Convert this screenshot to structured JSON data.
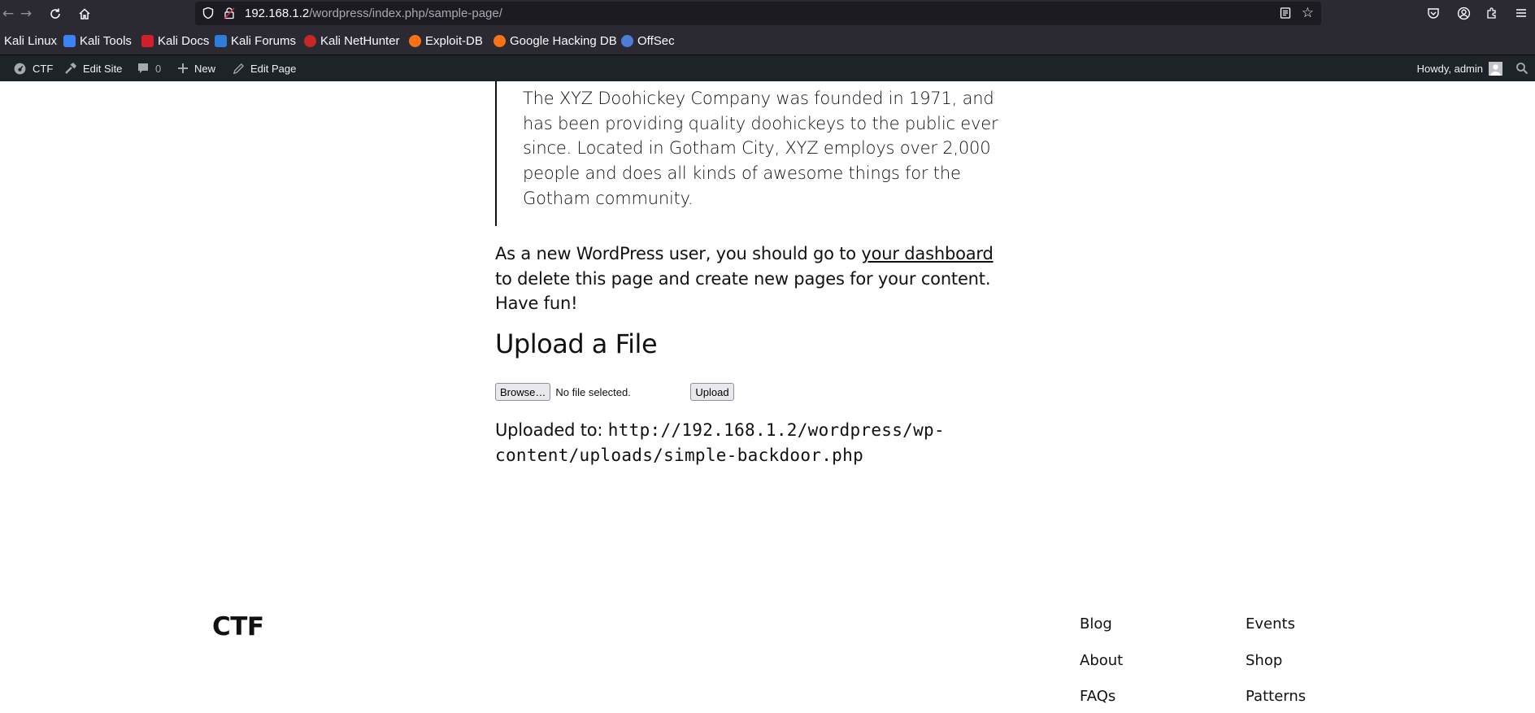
{
  "browser": {
    "url_host": "192.168.1.2",
    "url_path": "/wordpress/index.php/sample-page/",
    "bookmarks": [
      {
        "label": "Kali Linux"
      },
      {
        "label": "Kali Tools"
      },
      {
        "label": "Kali Docs"
      },
      {
        "label": "Kali Forums"
      },
      {
        "label": "Kali NetHunter"
      },
      {
        "label": "Exploit-DB"
      },
      {
        "label": "Google Hacking DB"
      },
      {
        "label": "OffSec"
      }
    ]
  },
  "adminbar": {
    "site_name": "CTF",
    "edit_site": "Edit Site",
    "comments_count": "0",
    "new_label": "New",
    "edit_page": "Edit Page",
    "howdy": "Howdy, admin"
  },
  "content": {
    "quote": "The XYZ Doohickey Company was founded in 1971, and has been providing quality doohickeys to the public ever since. Located in Gotham City, XYZ employs over 2,000 people and does all kinds of awesome things for the Gotham community.",
    "para_before_link": "As a new WordPress user, you should go to ",
    "para_link": "your dashboard",
    "para_after_link": " to delete this page and create new pages for your content. Have fun!",
    "upload_heading": "Upload a File",
    "browse_button": "Browse…",
    "no_file_text": "No file selected.",
    "upload_button": "Upload",
    "uploaded_label": "Uploaded to: ",
    "uploaded_path": "http://192.168.1.2/wordpress/wp-content/uploads/simple-backdoor.php"
  },
  "footer": {
    "site_title": "CTF",
    "links_col1": [
      "Blog",
      "About",
      "FAQs"
    ],
    "links_col2": [
      "Events",
      "Shop",
      "Patterns"
    ]
  }
}
